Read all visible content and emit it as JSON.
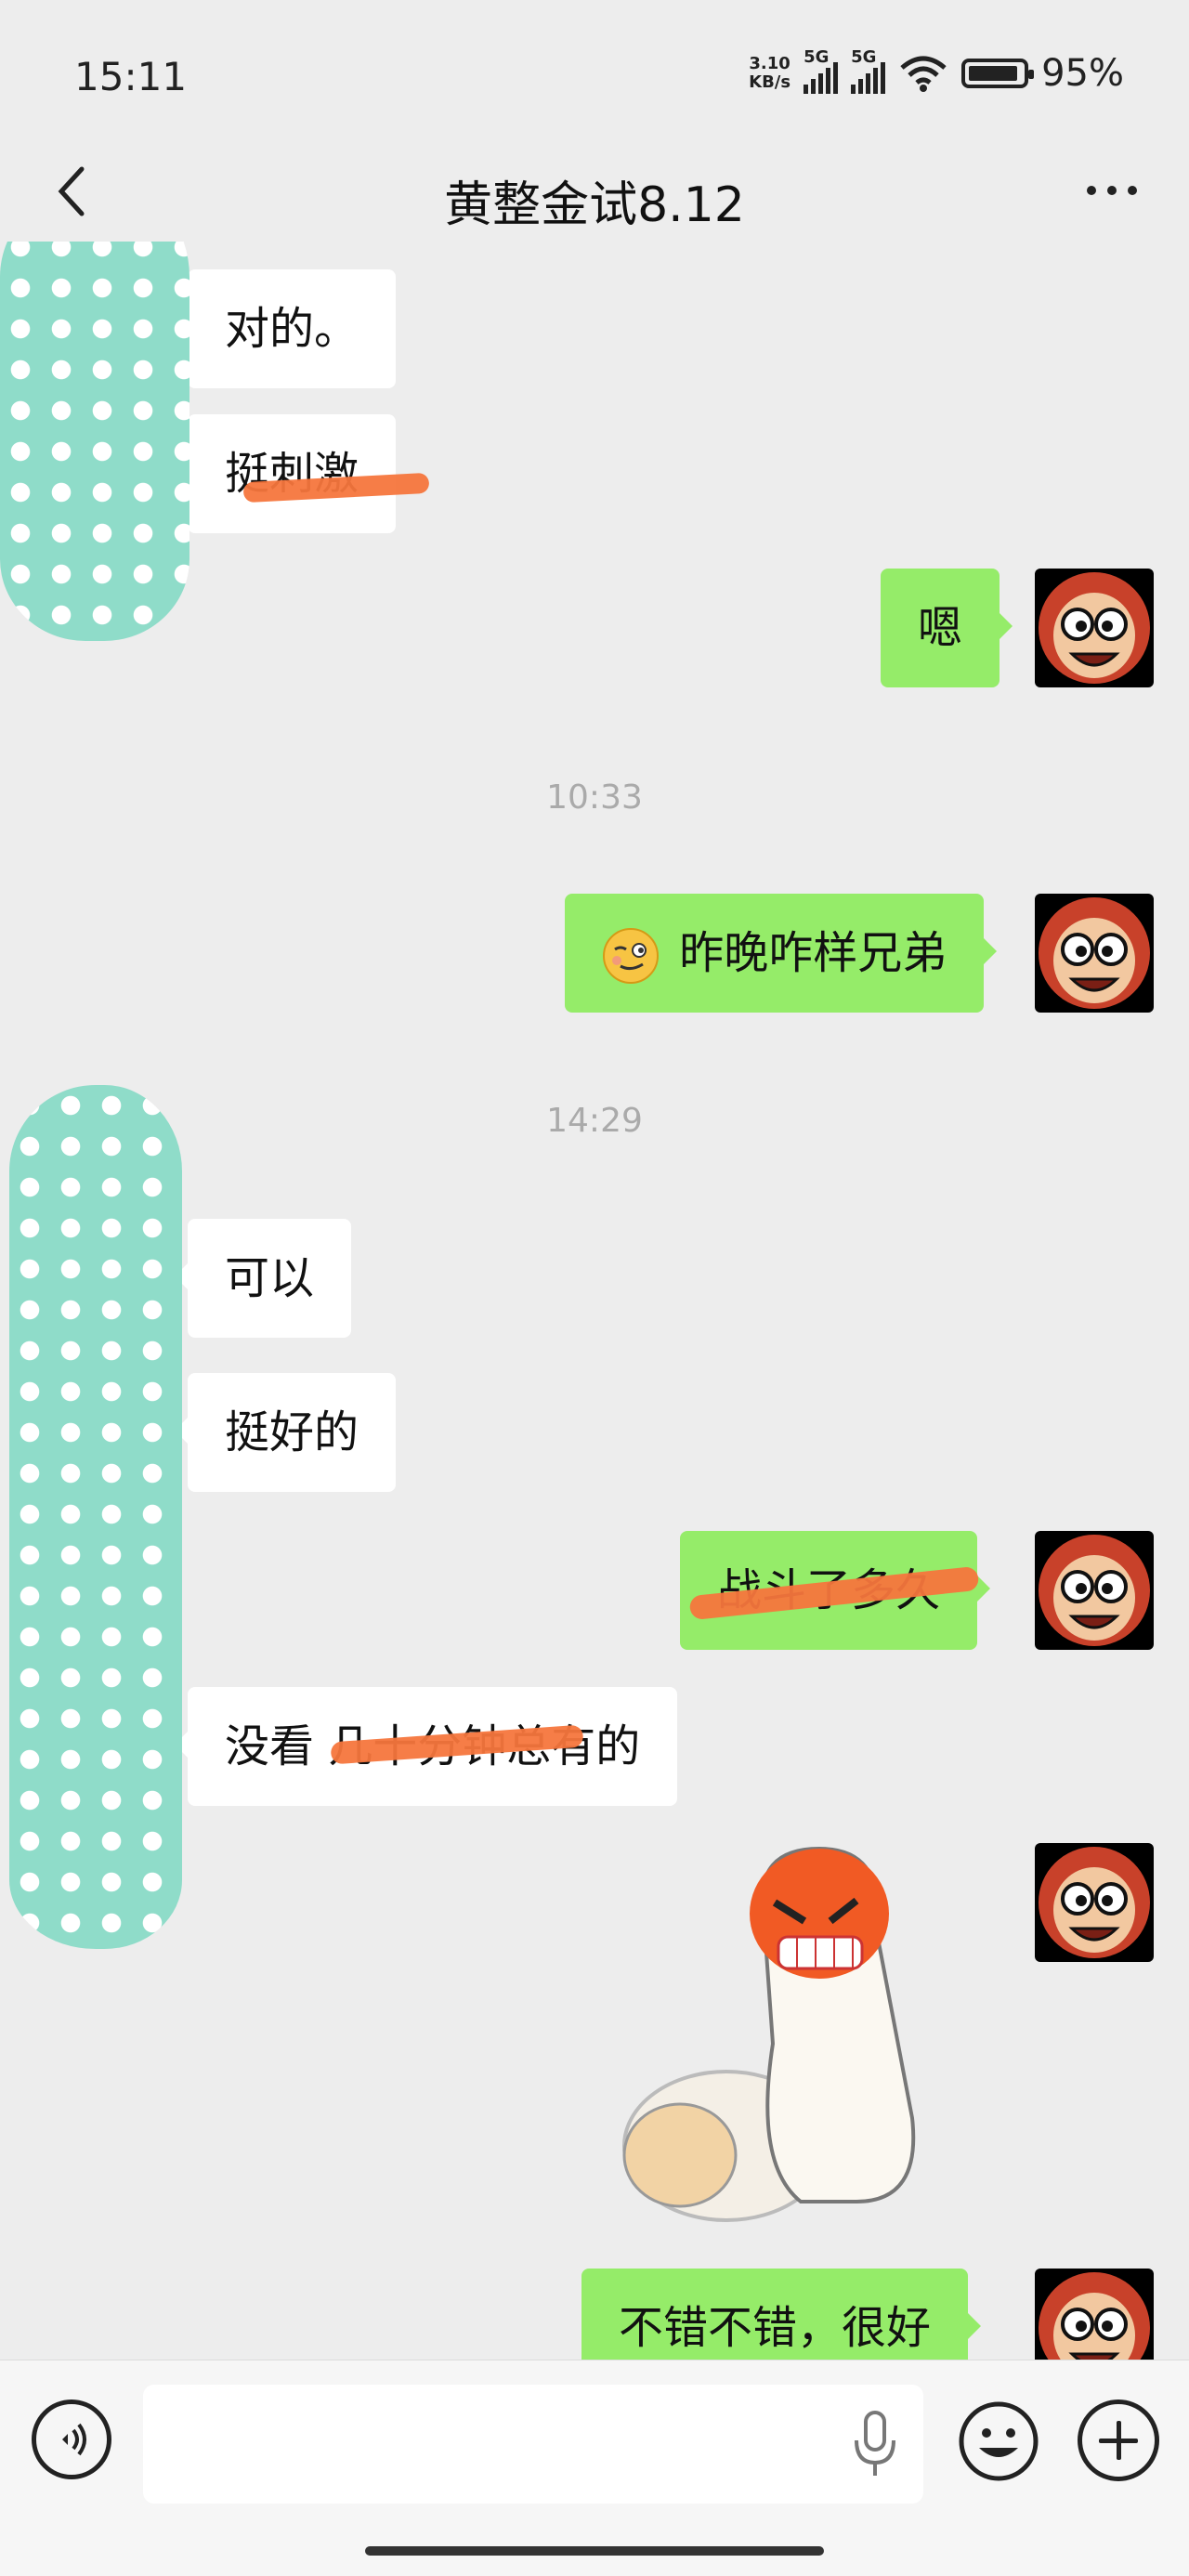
{
  "status_bar": {
    "time": "15:11",
    "net_speed_value": "3.10",
    "net_speed_unit": "KB/s",
    "signal1_label": "5G",
    "signal2_label": "5G",
    "battery": "95%"
  },
  "header": {
    "title": "黄整金试8.12"
  },
  "messages": [
    {
      "side": "left",
      "text": "对的。"
    },
    {
      "side": "left",
      "text": "挺刺激"
    },
    {
      "side": "right",
      "text": "嗯"
    },
    {
      "type": "timestamp",
      "text": "10:33"
    },
    {
      "side": "right",
      "text": "昨晚咋样兄弟",
      "leading_emoji": "smirk-emoji"
    },
    {
      "type": "timestamp",
      "text": "14:29"
    },
    {
      "side": "left",
      "text": "可以"
    },
    {
      "side": "left",
      "text": "挺好的"
    },
    {
      "side": "right",
      "text": "战斗了多久"
    },
    {
      "side": "left",
      "text": "没看 几十分钟总有的"
    },
    {
      "side": "right",
      "type": "sticker",
      "icon": "cartoon-sticker"
    },
    {
      "side": "right",
      "text": "不错不错，很好"
    }
  ],
  "input_bar": {
    "placeholder": "",
    "icons": [
      "voice-icon",
      "microphone-icon",
      "emoji-icon",
      "plus-icon"
    ]
  },
  "colors": {
    "background": "#ededed",
    "outgoing_bubble": "#95ec69",
    "incoming_bubble": "#ffffff",
    "redaction_scribble": "#f5763d",
    "redaction_blob": "#8fdcc9"
  }
}
